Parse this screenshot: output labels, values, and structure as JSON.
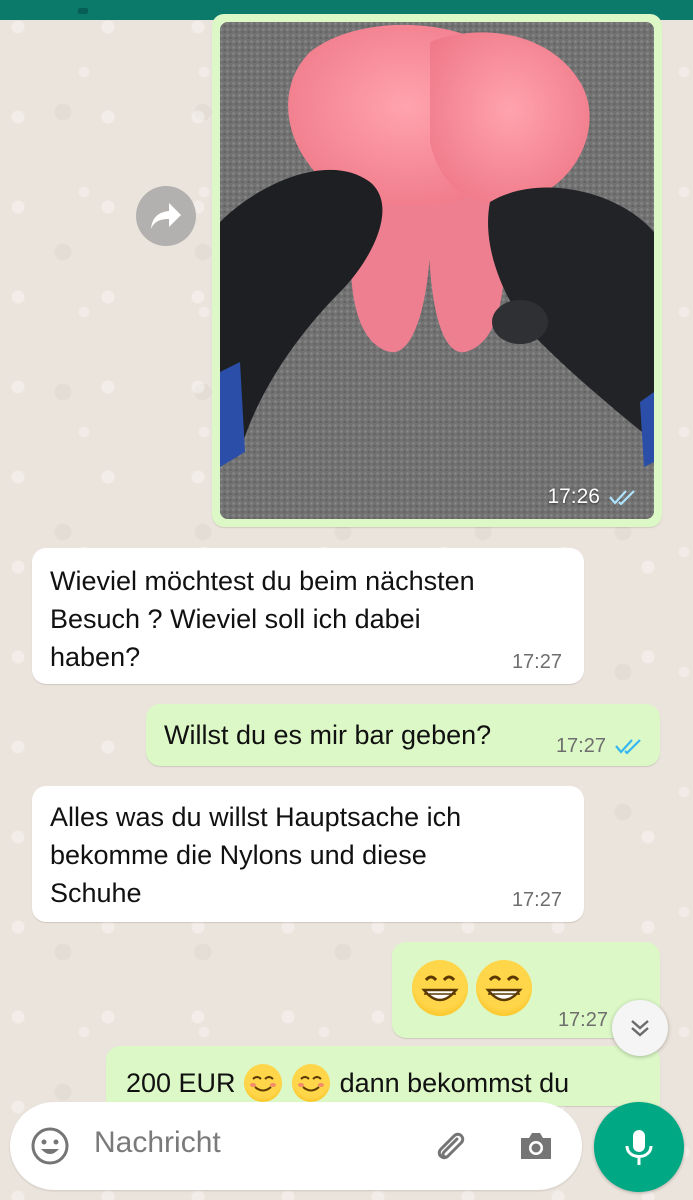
{
  "conversation": {
    "image_message": {
      "time": "17:26",
      "status": "read"
    },
    "messages": [
      {
        "id": "m1",
        "direction": "incoming",
        "text": "Wieviel möchtest du beim nächsten\nBesuch ? Wieviel soll ich dabei\nhaben?",
        "time": "17:27"
      },
      {
        "id": "m2",
        "direction": "outgoing",
        "text": "Willst du es mir bar geben?",
        "time": "17:27",
        "status": "read"
      },
      {
        "id": "m3",
        "direction": "incoming",
        "text": "Alles was du willst Hauptsache ich\nbekomme die Nylons und diese\nSchuhe",
        "time": "17:27"
      },
      {
        "id": "m4",
        "direction": "outgoing",
        "emojis": [
          "grinning-face",
          "grinning-face"
        ],
        "time": "17:27",
        "status": "read"
      },
      {
        "id": "m5",
        "direction": "outgoing",
        "text_before": "200 EUR",
        "text_after": "dann bekommst du",
        "emojis": [
          "smiling-face",
          "smiling-face"
        ]
      }
    ]
  },
  "composer": {
    "placeholder": "Nachricht",
    "icons": [
      "emoji-icon",
      "attach-icon",
      "camera-icon",
      "mic-icon"
    ]
  },
  "colors": {
    "header": "#0b7a6b",
    "outgoing_bubble": "#dcf8c6",
    "incoming_bubble": "#ffffff",
    "tick_read": "#34b7f1",
    "mic_button": "#00a884"
  }
}
